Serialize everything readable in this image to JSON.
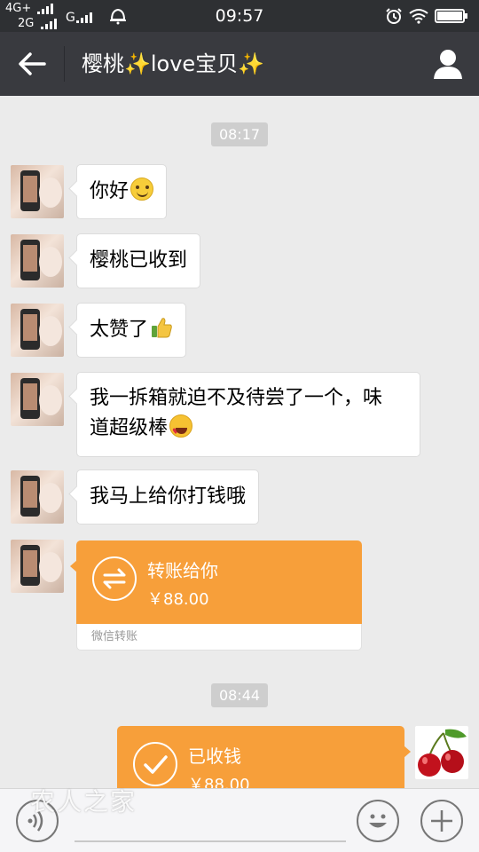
{
  "status_bar": {
    "network_top": "4G+",
    "network_bottom": "2G",
    "network_g": "G",
    "time": "09:57"
  },
  "header": {
    "title": "樱桃✨love宝贝✨"
  },
  "chat": {
    "timestamps": [
      "08:17",
      "08:44"
    ],
    "messages": [
      {
        "text": "你好",
        "emoji": "smile-emoji"
      },
      {
        "text": "樱桃已收到"
      },
      {
        "text": "太赞了",
        "emoji": "thumbs-up-emoji"
      },
      {
        "text": "我一拆箱就迫不及待尝了一个，味",
        "text2": "道超级棒",
        "emoji": "heart-eyes-emoji"
      },
      {
        "text": "我马上给你打钱哦"
      }
    ],
    "transfer_sent": {
      "title": "转账给你",
      "amount": "￥88.00",
      "footer": "微信转账"
    },
    "transfer_received": {
      "title": "已收钱",
      "amount": "￥88.00"
    }
  },
  "watermark": "农人之家",
  "colors": {
    "status_bar": "#2e3033",
    "title_bar": "#393a3f",
    "chat_bg": "#ebebeb",
    "transfer_orange": "#f79f3a"
  }
}
